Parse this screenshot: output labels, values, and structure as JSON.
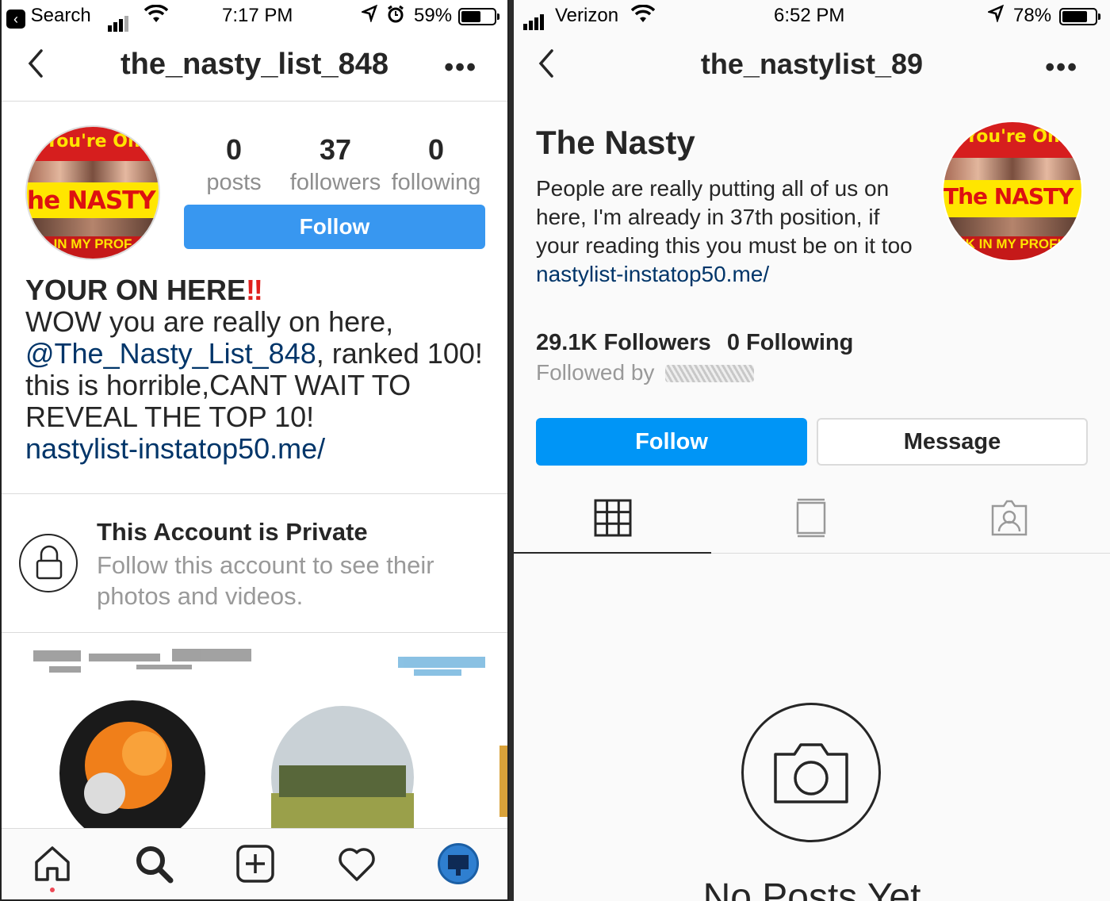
{
  "left": {
    "status": {
      "carrier": "Search",
      "time": "7:17 PM",
      "battery": "59%",
      "battery_fill": 0.59
    },
    "nav": {
      "title": "the_nasty_list_848"
    },
    "avatar": {
      "top_text": "You're On",
      "band_text": "he NASTY Lis",
      "bottom_text": "IN MY PROF"
    },
    "stats": [
      {
        "count": "0",
        "label": "posts"
      },
      {
        "count": "37",
        "label": "followers"
      },
      {
        "count": "0",
        "label": "following"
      }
    ],
    "follow_label": "Follow",
    "bio": {
      "heading": "YOUR ON HERE",
      "bang": "‼",
      "line1": "WOW you are really on here,",
      "mention": "@The_Nasty_List_848",
      "line2_rest": ",  ranked 100!",
      "line3": "this is horrible,CANT WAIT TO",
      "line4": "REVEAL THE TOP 10!",
      "link": "nastylist-instatop50.me/"
    },
    "private": {
      "title": "This Account is Private",
      "subtitle": "Follow this account to see their photos and videos."
    },
    "tabbar": [
      "home-icon",
      "search-icon",
      "add-icon",
      "heart-icon",
      "profile-avatar"
    ]
  },
  "right": {
    "status": {
      "carrier": "Verizon",
      "time": "6:52 PM",
      "battery": "78%",
      "battery_fill": 0.78
    },
    "nav": {
      "title": "the_nastylist_89"
    },
    "name": "The Nasty",
    "bio": "People are really putting all of us on here, I'm already in 37th position, if your reading this you must be on it too",
    "link": "nastylist-instatop50.me/",
    "followers": "29.1K Followers",
    "following": "0 Following",
    "followed_by_label": "Followed by",
    "avatar": {
      "top_text": "You're On",
      "band_text": "The NASTY List",
      "bottom_text": "NK IN MY PROFIL"
    },
    "follow_label": "Follow",
    "message_label": "Message",
    "empty_title": "No Posts Yet",
    "tabs": [
      "grid-icon",
      "feed-icon",
      "tagged-icon"
    ]
  },
  "colors": {
    "accent": "#3897f0",
    "accent_bright": "#0095f6",
    "link": "#003569",
    "muted": "#8e8e8e"
  }
}
